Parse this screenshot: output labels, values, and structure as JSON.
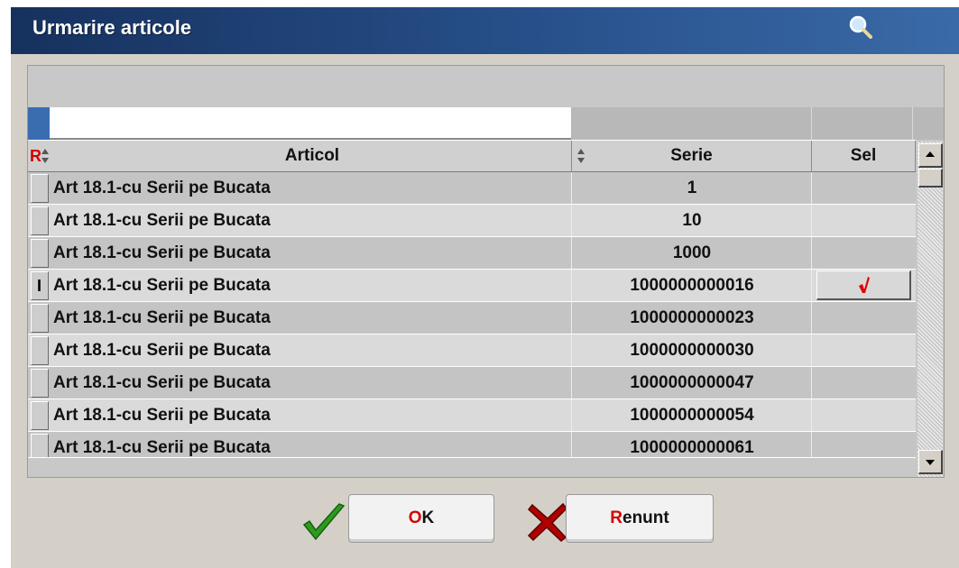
{
  "window": {
    "title": "Urmarire articole"
  },
  "grid": {
    "row_marker": "R",
    "columns": {
      "articol": "Articol",
      "serie": "Serie",
      "sel": "Sel"
    },
    "rows": [
      {
        "articol": "Art 18.1-cu Serii pe Bucata",
        "serie": "1",
        "selected": false
      },
      {
        "articol": "Art 18.1-cu Serii pe Bucata",
        "serie": "10",
        "selected": false
      },
      {
        "articol": "Art 18.1-cu Serii pe Bucata",
        "serie": "1000",
        "selected": false
      },
      {
        "articol": "Art 18.1-cu Serii pe Bucata",
        "serie": "1000000000016",
        "selected": true
      },
      {
        "articol": "Art 18.1-cu Serii pe Bucata",
        "serie": "1000000000023",
        "selected": false
      },
      {
        "articol": "Art 18.1-cu Serii pe Bucata",
        "serie": "1000000000030",
        "selected": false
      },
      {
        "articol": "Art 18.1-cu Serii pe Bucata",
        "serie": "1000000000047",
        "selected": false
      },
      {
        "articol": "Art 18.1-cu Serii pe Bucata",
        "serie": "1000000000054",
        "selected": false
      },
      {
        "articol": "Art 18.1-cu Serii pe Bucata",
        "serie": "1000000000061",
        "selected": false
      }
    ]
  },
  "buttons": {
    "ok": {
      "accel": "O",
      "rest": "K"
    },
    "cancel": {
      "accel": "R",
      "rest": "enunt"
    }
  },
  "colors": {
    "title_bar": "#1f3f72",
    "accel": "#d40000",
    "check": "#2e9b1e",
    "cross": "#b00000"
  }
}
